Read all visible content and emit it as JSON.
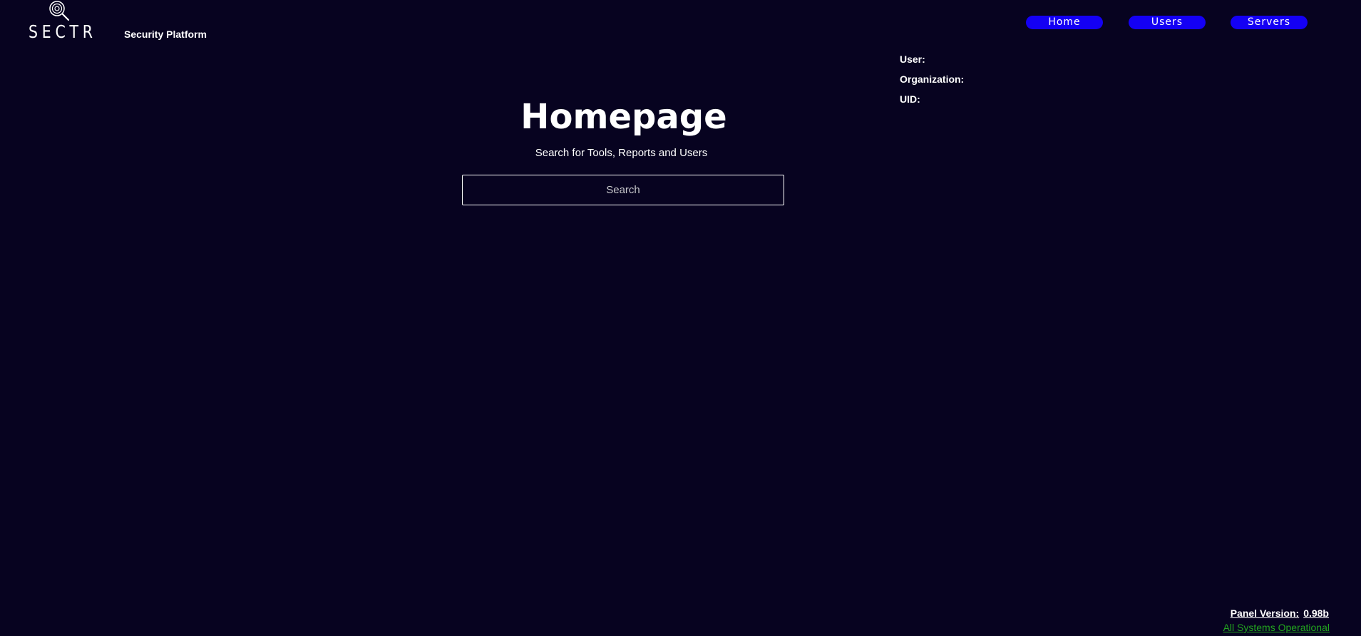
{
  "brand": {
    "name": "SECTR",
    "logo_icon": "magnifier-target-icon",
    "platform_label": "Security Platform"
  },
  "nav": {
    "items": [
      {
        "label": "Home"
      },
      {
        "label": "Users"
      },
      {
        "label": "Servers"
      }
    ],
    "accent_color": "#1400f4"
  },
  "user_info": {
    "user_label": "User:",
    "organization_label": "Organization:",
    "uid_label": "UID:"
  },
  "main": {
    "title": "Homepage",
    "subtitle": "Search for Tools, Reports and Users",
    "search": {
      "placeholder": "Search",
      "value": ""
    }
  },
  "footer": {
    "panel_version_label": "Panel Version:",
    "panel_version_value": "0.98b",
    "status_text": "All Systems Operational",
    "status_color": "#23a51f"
  },
  "colors": {
    "background": "#070320",
    "text": "#ffffff"
  }
}
